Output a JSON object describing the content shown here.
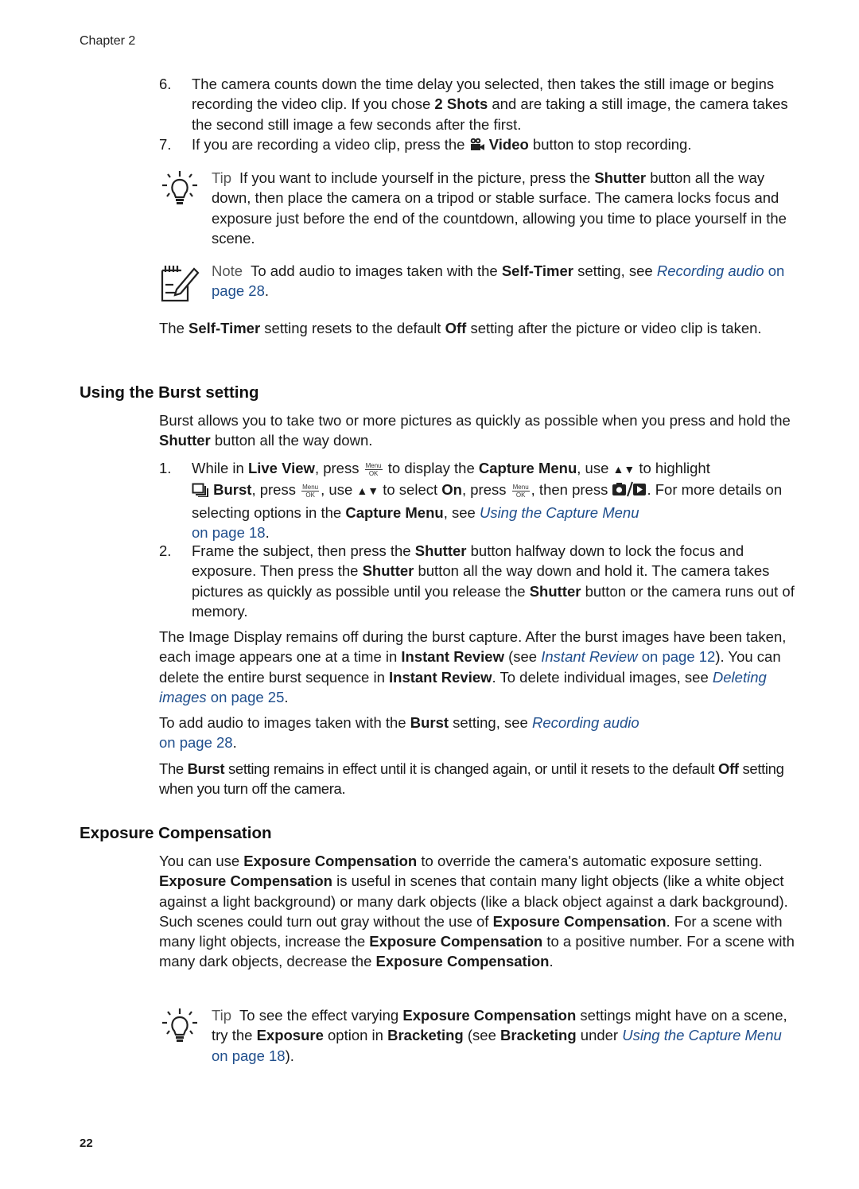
{
  "header": {
    "chapter": "Chapter 2"
  },
  "steps_top": [
    {
      "num": "6.",
      "parts": [
        "The camera counts down the time delay you selected, then takes the still image or begins recording the video clip. If you chose ",
        "2 Shots",
        " and are taking a still image, the camera takes the second still image a few seconds after the first."
      ]
    },
    {
      "num": "7.",
      "parts": [
        "If you are recording a video clip, press the ",
        "Video",
        " button to stop recording."
      ],
      "icon": "video-camera-icon"
    }
  ],
  "tip1": {
    "label": "Tip",
    "parts": [
      "If you want to include yourself in the picture, press the ",
      "Shutter",
      " button all the way down, then place the camera on a tripod or stable surface. The camera locks focus and exposure just before the end of the countdown, allowing you time to place yourself in the scene."
    ]
  },
  "note1": {
    "label": "Note",
    "parts": [
      "To add audio to images taken with the ",
      "Self-Timer",
      " setting, see "
    ],
    "link_italic": "Recording audio",
    "link_rest": " on page 28",
    "end": "."
  },
  "selftimer_para": {
    "parts": [
      "The ",
      "Self-Timer",
      " setting resets to the default ",
      "Off",
      " setting after the picture or video clip is taken."
    ]
  },
  "burst": {
    "heading": "Using the Burst setting",
    "intro": [
      "Burst allows you to take two or more pictures as quickly as possible when you press and hold the ",
      "Shutter",
      " button all the way down."
    ],
    "step1": {
      "num": "1.",
      "t1": "While in ",
      "b1": "Live View",
      "t2": ", press ",
      "t3": " to display the ",
      "b2": "Capture Menu",
      "t4": ", use ",
      "t5": " to highlight ",
      "b3": "Burst",
      "t6": ", press ",
      "t7": ", use ",
      "t8": " to select ",
      "b4": "On",
      "t9": ", press ",
      "t10": ", then press ",
      "t11": ". For more details on selecting options in the ",
      "b5": "Capture Menu",
      "t12": ", see ",
      "link_italic": "Using the Capture Menu",
      "link_rest": " on page 18",
      "end": ".",
      "menu_top": "Menu",
      "menu_bottom": "OK",
      "arrows": "▲▼"
    },
    "step2": {
      "num": "2.",
      "parts": [
        "Frame the subject, then press the ",
        "Shutter",
        " button halfway down to lock the focus and exposure. Then press the ",
        "Shutter",
        " button all the way down and hold it. The camera takes pictures as quickly as possible until you release the ",
        "Shutter",
        " button or the camera runs out of memory."
      ]
    },
    "para1": {
      "t1": "The Image Display remains off during the burst capture. After the burst images have been taken, each image appears one at a time in ",
      "b1": "Instant Review",
      "t2": " (see ",
      "link1_italic": "Instant Review",
      "link1_rest": " on page 12",
      "t3": "). You can delete the entire burst sequence in ",
      "b2": "Instant Review",
      "t4": ". To delete individual images, see ",
      "link2_italic": "Deleting images",
      "link2_rest": " on page 25",
      "t5": "."
    },
    "para2": {
      "t1": "To add audio to images taken with the ",
      "b1": "Burst",
      "t2": " setting, see ",
      "link_italic": "Recording audio",
      "link_rest": "on page 28",
      "end": "."
    },
    "para3": {
      "parts": [
        "The ",
        "Burst",
        " setting remains in effect until it is changed again, or until it resets to the default ",
        "Off",
        " setting when you turn off the camera."
      ]
    }
  },
  "exposure": {
    "heading": "Exposure Compensation",
    "para": {
      "t1": "You can use ",
      "b1": "Exposure Compensation",
      "t2": " to override the camera's automatic exposure setting. ",
      "b2": "Exposure Compensation",
      "t3": " is useful in scenes that contain many light objects (like a white object against a light background) or many dark objects (like a black object against a dark background). Such scenes could turn out gray without the use of ",
      "b3": "Exposure Compensation",
      "t4": ". For a scene with many light objects, increase the ",
      "b4": "Exposure Compensation",
      "t5": " to a positive number. For a scene with many dark objects, decrease the ",
      "b5": "Exposure Compensation",
      "t6": "."
    },
    "tip": {
      "label": "Tip",
      "t1": "To see the effect varying ",
      "b1": "Exposure Compensation",
      "t2": " settings might have on a scene, try the ",
      "b2": "Exposure",
      "t3": " option in ",
      "b3": "Bracketing",
      "t4": " (see ",
      "b4": "Bracketing",
      "t5": " under ",
      "link_italic": "Using the Capture Menu",
      "link_rest": " on page 18",
      "end": ")."
    }
  },
  "footer": {
    "page_number": "22"
  },
  "colors": {
    "link": "#1f4e8c",
    "label": "#555555",
    "text": "#1a1a1a"
  }
}
